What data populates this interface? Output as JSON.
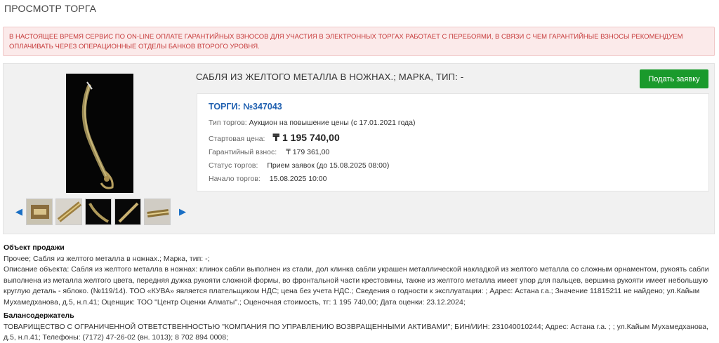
{
  "page": {
    "title": "ПРОСМОТР ТОРГА"
  },
  "alert": {
    "text": "В НАСТОЯЩЕЕ ВРЕМЯ СЕРВИС ПО ON-LINE ОПЛАТЕ ГАРАНТИЙНЫХ ВЗНОСОВ ДЛЯ УЧАСТИЯ В ЭЛЕКТРОННЫХ ТОРГАХ РАБОТАЕТ С ПЕРЕБОЯМИ, В СВЯЗИ С ЧЕМ ГАРАНТИЙНЫЕ ВЗНОСЫ РЕКОМЕНДУЕМ ОПЛАЧИВАТЬ ЧЕРЕЗ ОПЕРАЦИОННЫЕ ОТДЕЛЫ БАНКОВ ВТОРОГО УРОВНЯ."
  },
  "lot": {
    "title": "САБЛЯ ИЗ ЖЕЛТОГО МЕТАЛЛА В НОЖНАХ.; МАРКА, ТИП: -",
    "bid_button": "Подать заявку",
    "auction_label": "ТОРГИ: №347043",
    "type_label": "Тип торгов:",
    "type_value": "Аукцион на повышение цены (с 17.01.2021 года)",
    "start_price_label": "Стартовая цена:",
    "start_price_value": "₸ 1 195 740,00",
    "deposit_label": "Гарантийный взнос:",
    "deposit_value": "₸ 179 361,00",
    "status_label": "Статус торгов:",
    "status_value": "Прием заявок (до 15.08.2025 08:00)",
    "start_label": "Начало торгов:",
    "start_value": "15.08.2025 10:00"
  },
  "gallery": {
    "prev_icon": "◀",
    "next_icon": "▶",
    "thumbnail_count": 5
  },
  "object": {
    "heading": "Объект продажи",
    "line1": "Прочее; Сабля из желтого металла в ножнах.; Марка, тип: -;",
    "description": "Описание объекта: Сабля из желтого металла в ножнах: клинок сабли выполнен из стали, дол клинка сабли украшен металлической накладкой из желтого металла со сложным орнаментом, рукоять сабли выполнена из металла желтого цвета, передняя дужка рукояти сложной формы, во фронтальной части крестовины, также из желтого металла имеет упор для пальцев, вершина рукояти имеет небольшую круглую деталь - яблоко. (№119/14). ТОО «КУВА» является плательщиком НДС; цена без учета НДС.; Сведения о годности к эксплуатации: ; Адрес: Астана г.а.; Значение 11815211 не найдено; ул.Кайым Мухамедханова, д.5, н.п.41; Оценщик: ТОО \"Центр Оценки Алматы\".; Оценочная стоимость, тг: 1 195 740,00; Дата оценки: 23.12.2024;"
  },
  "holder": {
    "heading": "Балансодержатель",
    "text": "ТОВАРИЩЕСТВО С ОГРАНИЧЕННОЙ ОТВЕТСТВЕННОСТЬЮ \"КОМПАНИЯ ПО УПРАВЛЕНИЮ ВОЗВРАЩЕННЫМИ АКТИВАМИ\"; БИН/ИИН: 231040010244; Адрес: Астана г.а. ; ; ул.Кайым Мухамедханова, д.5, н.п.41; Телефоны: (7172) 47-26-02 (вн. 1013); 8 702 894 0008;"
  },
  "colors": {
    "accent_blue": "#2060b0",
    "button_green": "#1a9a2c",
    "alert_red": "#c63b3b"
  }
}
